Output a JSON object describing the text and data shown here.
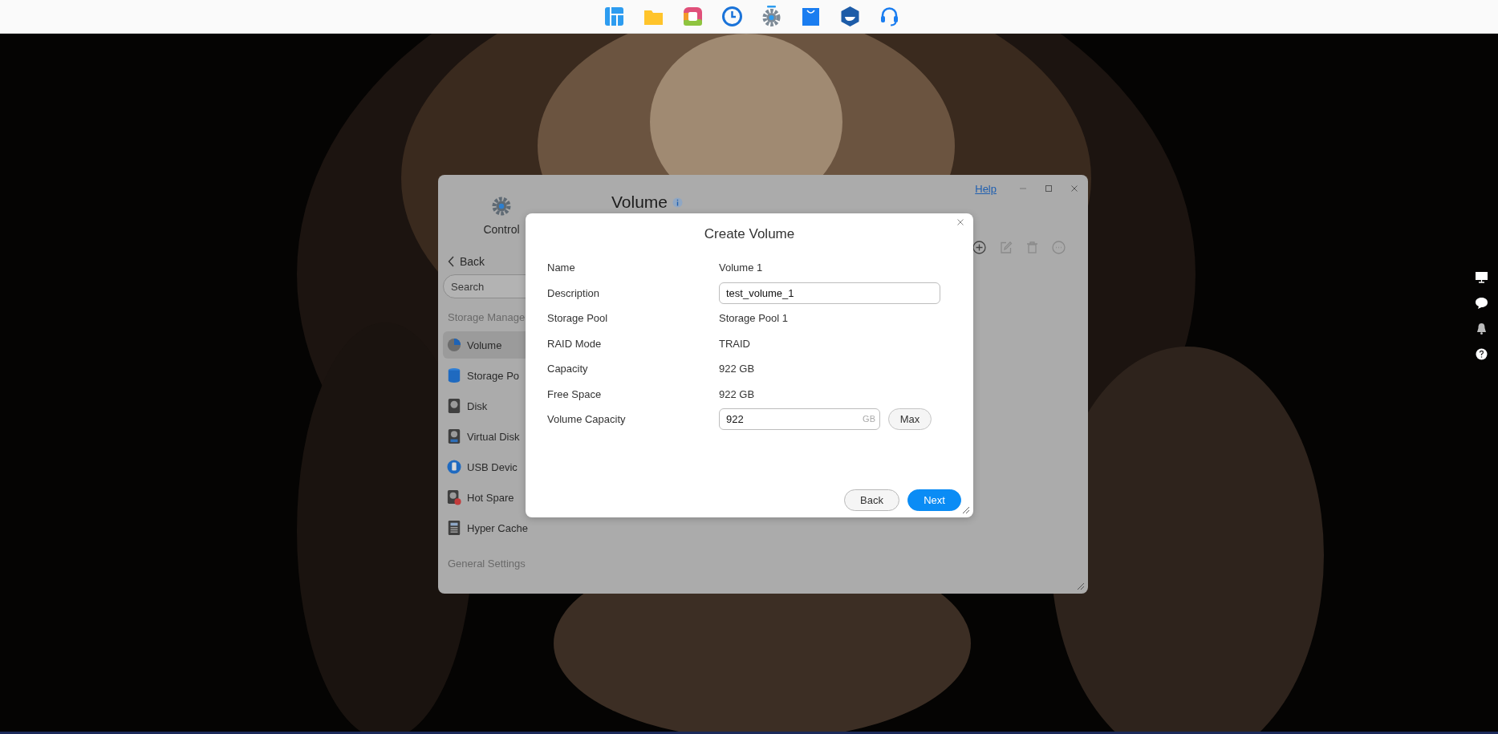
{
  "window": {
    "help_link": "Help",
    "app_title": "Control",
    "page_title": "Volume"
  },
  "sidebar": {
    "back": "Back",
    "search": {
      "placeholder": "Search"
    },
    "sections": [
      {
        "heading": "Storage Manage",
        "items": [
          {
            "label": "Volume",
            "kind": "volume",
            "selected": true
          },
          {
            "label": "Storage Po",
            "kind": "pool",
            "selected": false
          },
          {
            "label": "Disk",
            "kind": "disk",
            "selected": false
          },
          {
            "label": "Virtual Disk",
            "kind": "virtual-disk",
            "selected": false
          },
          {
            "label": "USB Devic",
            "kind": "usb",
            "selected": false
          },
          {
            "label": "Hot Spare",
            "kind": "hot-spare",
            "selected": false
          },
          {
            "label": "Hyper Cache",
            "kind": "cache",
            "selected": false
          }
        ]
      },
      {
        "heading": "General Settings"
      }
    ]
  },
  "dialog": {
    "title": "Create Volume",
    "rows": [
      {
        "kind": "text",
        "label": "Name",
        "value": "Volume 1"
      },
      {
        "kind": "input",
        "label": "Description",
        "value": "test_volume_1"
      },
      {
        "kind": "text",
        "label": "Storage Pool",
        "value": "Storage Pool 1"
      },
      {
        "kind": "text",
        "label": "RAID Mode",
        "value": "TRAID"
      },
      {
        "kind": "text",
        "label": "Capacity",
        "value": "922 GB"
      },
      {
        "kind": "text",
        "label": "Free Space",
        "value": "922 GB"
      },
      {
        "kind": "capacity",
        "label": "Volume Capacity",
        "value": "922",
        "unit": "GB",
        "button": "Max"
      }
    ],
    "buttons": [
      {
        "label": "Back",
        "kind": "secondary"
      },
      {
        "label": "Next",
        "kind": "primary"
      }
    ]
  }
}
